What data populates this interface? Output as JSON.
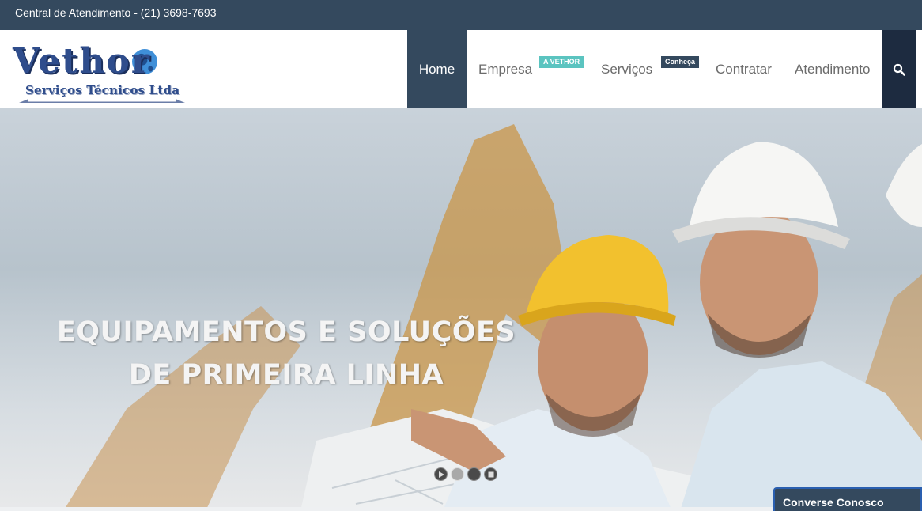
{
  "topbar": {
    "contact": "Central de Atendimento - (21) 3698-7693"
  },
  "logo": {
    "word": "Vethor",
    "subtitle": "Serviços Técnicos Ltda"
  },
  "nav": {
    "items": [
      {
        "label": "Home",
        "active": true
      },
      {
        "label": "Empresa",
        "badge": "A VETHOR"
      },
      {
        "label": "Serviços",
        "badge": "Conheça"
      },
      {
        "label": "Contratar"
      },
      {
        "label": "Atendimento"
      }
    ],
    "search_icon": "search-icon"
  },
  "hero": {
    "title_line1": "EQUIPAMENTOS E SOLUÇÕES",
    "title_line2": "DE PRIMEIRA LINHA",
    "controls": [
      "play-icon",
      "dot-active",
      "dot",
      "stop-icon"
    ]
  },
  "chat": {
    "label": "Converse Conosco"
  },
  "colors": {
    "primary": "#34495e",
    "search_bg": "#1d2b40",
    "badge_empresa": "#5bc4c0",
    "badge_servicos": "#34495e",
    "nav_text": "#6b6b6b"
  }
}
